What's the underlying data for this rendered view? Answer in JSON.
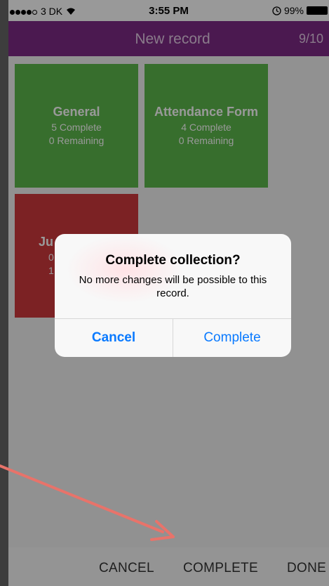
{
  "status_bar": {
    "carrier": "3 DK",
    "time": "3:55 PM",
    "battery": "99%"
  },
  "nav": {
    "title": "New record",
    "count": "9/10"
  },
  "tiles": [
    {
      "title": "General",
      "line1": "5 Complete",
      "line2": "0 Remaining",
      "color": "#5cb84c"
    },
    {
      "title": "Attendance Form",
      "line1": "4 Complete",
      "line2": "0 Remaining",
      "color": "#5cb84c"
    },
    {
      "title": "Ju",
      "line1": "0",
      "line2": "1",
      "color": "#cf3a3d"
    }
  ],
  "alert": {
    "title": "Complete collection?",
    "message": "No more changes will be possible to this record.",
    "cancel_label": "Cancel",
    "complete_label": "Complete"
  },
  "toolbar": {
    "cancel_label": "CANCEL",
    "complete_label": "COMPLETE",
    "done_label": "DONE"
  },
  "colors": {
    "nav_bg": "#7d2a85",
    "tile_complete": "#5cb84c",
    "tile_incomplete": "#cf3a3d",
    "alert_button": "#0a7aff",
    "annotation_arrow": "#e8736a"
  },
  "icons": {
    "wifi": "wifi-icon",
    "alarm": "alarm-icon",
    "battery": "battery-icon"
  }
}
